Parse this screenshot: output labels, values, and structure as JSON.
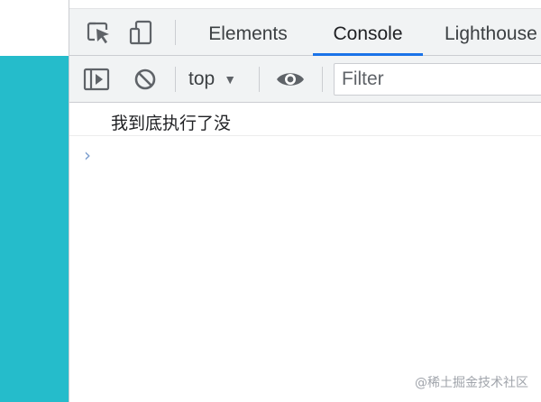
{
  "tabs": [
    {
      "label": "Elements",
      "active": false
    },
    {
      "label": "Console",
      "active": true
    },
    {
      "label": "Lighthouse",
      "active": false
    }
  ],
  "toolbar": {
    "context": "top",
    "filter_placeholder": "Filter"
  },
  "console": {
    "logs": [
      {
        "text": "我到底执行了没"
      }
    ],
    "prompt_icon": "chevron-right-icon"
  },
  "watermark": "@稀土掘金技术社区",
  "colors": {
    "page_accent": "#25bccb",
    "active_tab_underline": "#1a73e8",
    "toolbar_background": "#f1f3f4",
    "prompt": "#7d9fcf"
  },
  "icons": {
    "inspect": "inspect-element-icon",
    "device": "device-toolbar-icon",
    "sidebar": "console-sidebar-icon",
    "clear": "clear-console-icon",
    "eye": "live-expression-eye-icon",
    "dropdown": "dropdown-arrow-icon"
  }
}
